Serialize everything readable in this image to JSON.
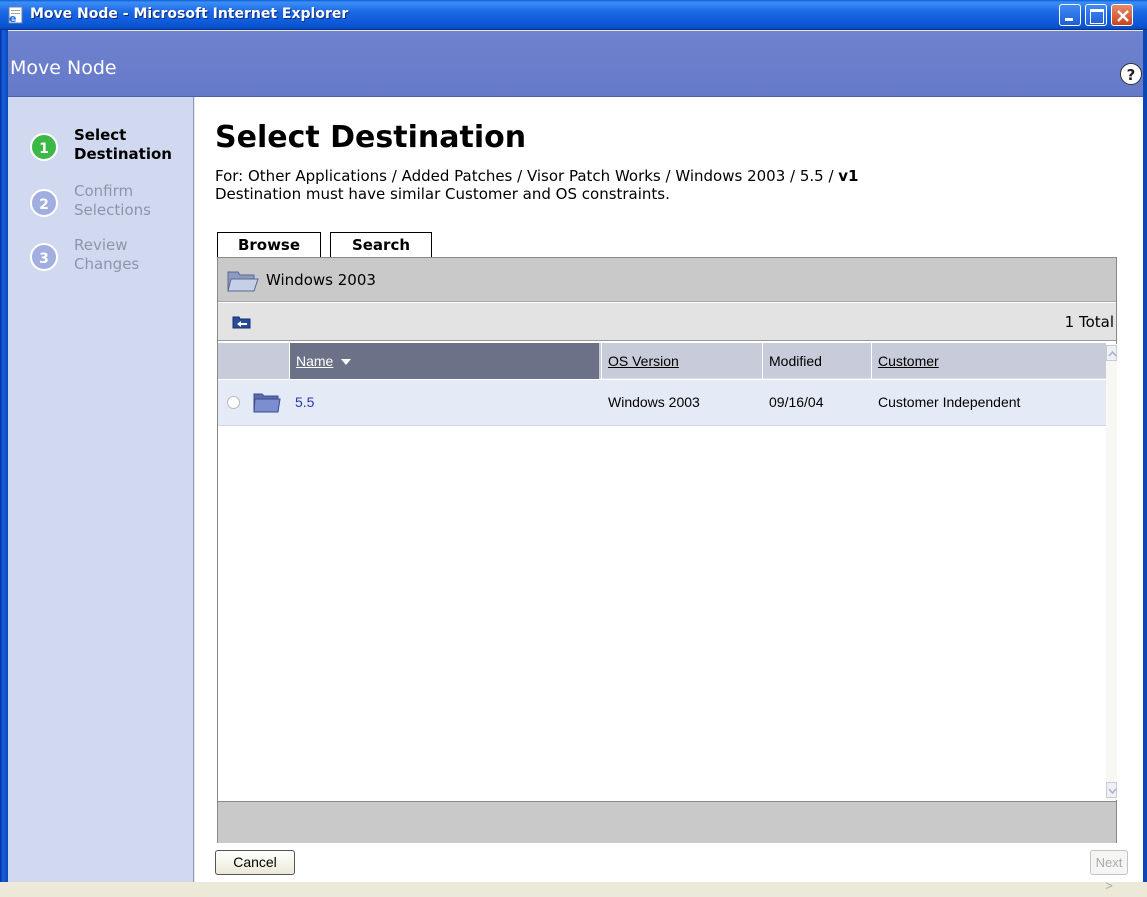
{
  "window": {
    "title": "Move Node - Microsoft Internet Explorer"
  },
  "header": {
    "title": "Move Node",
    "help_icon": "?"
  },
  "steps": [
    {
      "number": "1",
      "label_line1": "Select",
      "label_line2": "Destination",
      "state": "active"
    },
    {
      "number": "2",
      "label_line1": "Confirm",
      "label_line2": "Selections",
      "state": "inactive"
    },
    {
      "number": "3",
      "label_line1": "Review",
      "label_line2": "Changes",
      "state": "inactive"
    }
  ],
  "main": {
    "title": "Select Destination",
    "for_prefix": "For: Other Applications / Added Patches / Visor Patch Works / Windows 2003 / 5.5 / ",
    "for_bold": "v1",
    "constraint_text": "Destination must have similar Customer and OS constraints."
  },
  "tabs": [
    {
      "label": "Browse",
      "selected": true
    },
    {
      "label": "Search",
      "selected": false
    }
  ],
  "browse": {
    "current_folder": "Windows 2003",
    "total": "1 Total"
  },
  "table": {
    "columns": [
      "Name",
      "OS Version",
      "Modified",
      "Customer"
    ],
    "rows": [
      {
        "name": "5.5",
        "os_version": "Windows 2003",
        "modified": "09/16/04",
        "customer": "Customer Independent"
      }
    ]
  },
  "buttons": {
    "cancel": "Cancel",
    "next": "Next >"
  },
  "colors": {
    "header_band": "#6e83cf",
    "step_active": "#3bb846",
    "step_inactive": "#a2aee0",
    "link": "#2a3aa8"
  }
}
